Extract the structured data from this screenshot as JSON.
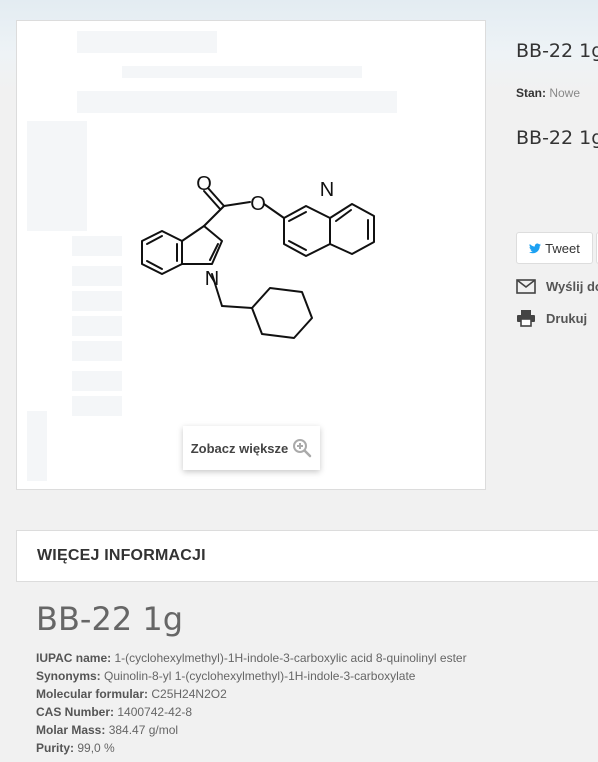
{
  "product": {
    "title": "BB-22 1g",
    "title_short": "BB-22 1g",
    "condition_label": "Stan:",
    "condition_value": "Nowe"
  },
  "image": {
    "zoom_label": "Zobacz większe",
    "atom_O1": "O",
    "atom_O2": "O",
    "atom_N_quinoline": "N",
    "atom_N_indole": "N"
  },
  "share": {
    "tweet_label": "Tweet",
    "send_label": "Wyślij do",
    "print_label": "Drukuj"
  },
  "more_info": {
    "header": "WIĘCEJ INFORMACJI",
    "title": "BB-22 1g",
    "rows": [
      {
        "label": "IUPAC name:",
        "value": "1-(cyclohexylmethyl)-1H-indole-3-carboxylic acid 8-quinolinyl ester"
      },
      {
        "label": "Synonyms:",
        "value": "Quinolin-8-yl 1-(cyclohexylmethyl)-1H-indole-3-carboxylate"
      },
      {
        "label": "Molecular formular:",
        "value": "C25H24N2O2"
      },
      {
        "label": "CAS Number:",
        "value": "1400742-42-8"
      },
      {
        "label": "Molar Mass:",
        "value": "384.47 g/mol"
      },
      {
        "label": "Purity:",
        "value": "99,0 %"
      }
    ]
  },
  "colors": {
    "twitter": "#1da1f2",
    "background": "#f1f1f1"
  },
  "icons": {
    "zoom": "zoom-in-icon",
    "twitter": "twitter-bird-icon",
    "mail": "envelope-icon",
    "print": "printer-icon"
  }
}
